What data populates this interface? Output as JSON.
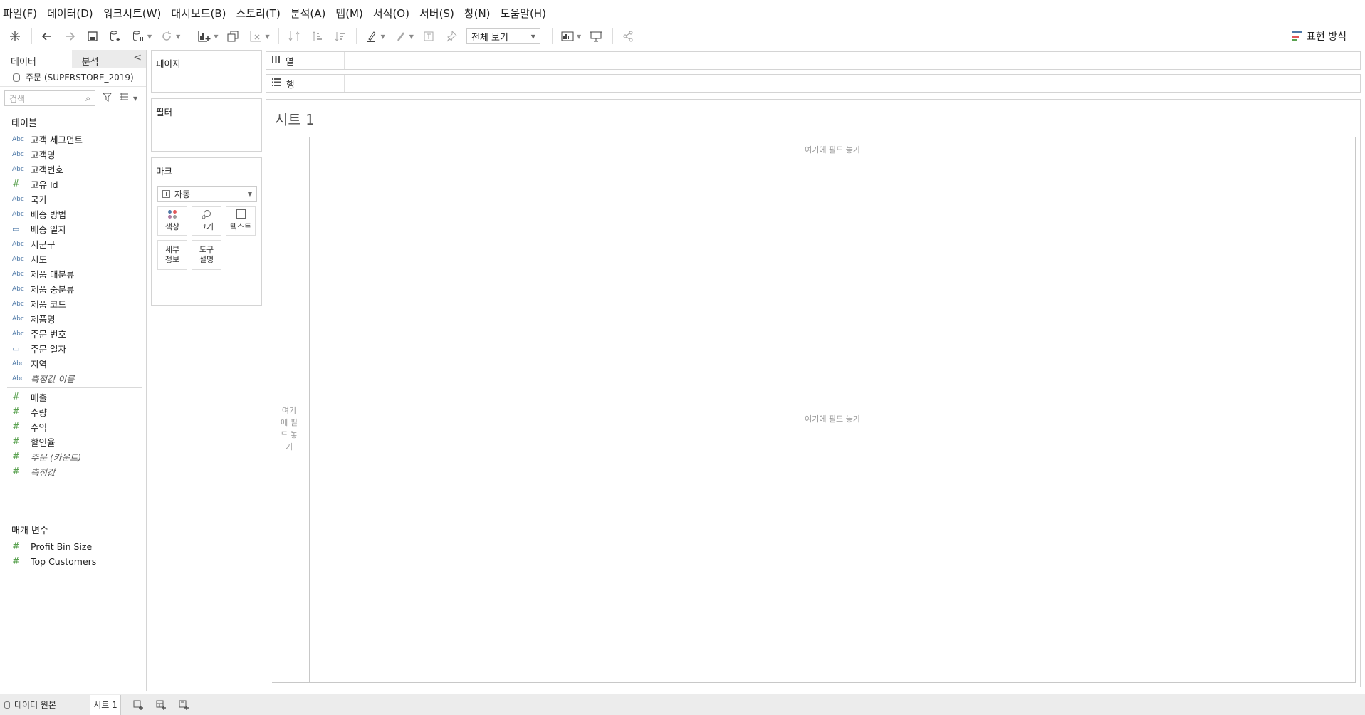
{
  "menu": [
    "파일(F)",
    "데이터(D)",
    "워크시트(W)",
    "대시보드(B)",
    "스토리(T)",
    "분석(A)",
    "맵(M)",
    "서식(O)",
    "서버(S)",
    "창(N)",
    "도움말(H)"
  ],
  "toolbar": {
    "fit_label": "전체 보기",
    "show_me_label": "표현 방식",
    "show_me_colors": [
      "#4e79a7",
      "#e15759",
      "#59a14f"
    ]
  },
  "data_pane": {
    "tab_data": "데이터",
    "tab_analytics": "분석",
    "collapse": "<",
    "datasource": "주문 (SUPERSTORE_2019)",
    "search_placeholder": "검색",
    "tables_header": "테이블",
    "dimensions": [
      {
        "type": "Abc",
        "label": "고객 세그먼트"
      },
      {
        "type": "Abc",
        "label": "고객명"
      },
      {
        "type": "Abc",
        "label": "고객번호"
      },
      {
        "type": "#",
        "label": "고유 Id"
      },
      {
        "type": "Abc",
        "label": "국가"
      },
      {
        "type": "Abc",
        "label": "배송 방법"
      },
      {
        "type": "date",
        "label": "배송 일자"
      },
      {
        "type": "Abc",
        "label": "시군구"
      },
      {
        "type": "Abc",
        "label": "시도"
      },
      {
        "type": "Abc",
        "label": "제품 대분류"
      },
      {
        "type": "Abc",
        "label": "제품 중분류"
      },
      {
        "type": "Abc",
        "label": "제품 코드"
      },
      {
        "type": "Abc",
        "label": "제품명"
      },
      {
        "type": "Abc",
        "label": "주문 번호"
      },
      {
        "type": "date",
        "label": "주문 일자"
      },
      {
        "type": "Abc",
        "label": "지역"
      },
      {
        "type": "Abc",
        "label": "측정값 이름",
        "italic": true
      }
    ],
    "measures": [
      {
        "type": "#",
        "label": "매출"
      },
      {
        "type": "#",
        "label": "수량"
      },
      {
        "type": "#",
        "label": "수익"
      },
      {
        "type": "#",
        "label": "할인율"
      },
      {
        "type": "#",
        "label": "주문 (카운트)",
        "italic": true
      },
      {
        "type": "#",
        "label": "측정값",
        "italic": true
      }
    ],
    "params_header": "매개 변수",
    "params": [
      {
        "type": "#",
        "label": "Profit Bin Size"
      },
      {
        "type": "#",
        "label": "Top Customers"
      }
    ]
  },
  "shelves": {
    "pages": "페이지",
    "filters": "필터",
    "marks": "마크",
    "marks_type": "자동",
    "mark_buttons": [
      {
        "label": "색상",
        "icon": "color-icon"
      },
      {
        "label": "크기",
        "icon": "size-icon"
      },
      {
        "label": "텍스트",
        "icon": "text-icon"
      },
      {
        "label": "세부 정보",
        "icon": "detail-icon"
      },
      {
        "label": "도구 설명",
        "icon": "tooltip-icon"
      }
    ],
    "columns": "열",
    "rows": "행"
  },
  "sheet": {
    "title": "시트 1",
    "drop_columns": "여기에 필드 놓기",
    "drop_rows": "여기에 필드 놓기",
    "drop_body": "여기에 필드 놓기"
  },
  "tabs": {
    "datasource": "데이터 원본",
    "sheet": "시트 1"
  }
}
